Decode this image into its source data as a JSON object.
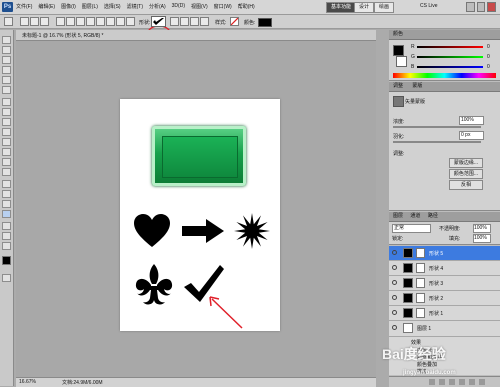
{
  "app": {
    "logo": "Ps",
    "zoom_select": "16.7",
    "menus": [
      "文件(F)",
      "编辑(E)",
      "图像(I)",
      "图层(L)",
      "选择(S)",
      "滤镜(T)",
      "分析(A)",
      "3D(D)",
      "视图(V)",
      "窗口(W)",
      "帮助(H)"
    ],
    "workspace_buttons": [
      "基本功能",
      "设计",
      "绘画"
    ],
    "cs_live": "CS Live"
  },
  "options_bar": {
    "shape_label": "形状:",
    "style_label": "样式:",
    "color_label": "颜色:"
  },
  "document": {
    "tab_title": "未标题-1 @ 16.7% (形状 5, RGB/8) *",
    "status_zoom": "16.67%",
    "status_doc": "文档:24.9M/6.00M"
  },
  "color_panel": {
    "tab": "颜色",
    "channels": [
      "R",
      "G",
      "B"
    ],
    "values": [
      "0",
      "0",
      "0"
    ]
  },
  "adjust_panel": {
    "tab": "调整",
    "tab2": "蒙版",
    "title": "矢量蒙版",
    "density_label": "浓度:",
    "density_value": "100%",
    "feather_label": "羽化:",
    "feather_value": "0 px",
    "refine_label": "调整:",
    "btn_mask_edge": "蒙版边缘...",
    "btn_color_range": "颜色范围...",
    "btn_invert": "反相"
  },
  "layers_panel": {
    "tabs": [
      "图层",
      "通道",
      "路径"
    ],
    "blend_mode": "正常",
    "opacity_label": "不透明度:",
    "opacity_value": "100%",
    "lock_label": "锁定:",
    "fill_label": "填充:",
    "fill_value": "100%",
    "layers": [
      {
        "name": "形状 5",
        "selected": true
      },
      {
        "name": "形状 4",
        "selected": false
      },
      {
        "name": "形状 3",
        "selected": false
      },
      {
        "name": "形状 2",
        "selected": false
      },
      {
        "name": "形状 1",
        "selected": false
      }
    ],
    "group_layer": "图层 1",
    "effects_label": "效果",
    "effects": [
      "内发光",
      "斜面和浮雕",
      "颜色叠加",
      "描边"
    ]
  },
  "watermark": {
    "brand": "Bai度经验",
    "url": "jingyan.baidu.com"
  },
  "colors": {
    "accent_red": "#e0202a",
    "button_green": "#16a14b",
    "selected_layer": "#3d7be0"
  }
}
